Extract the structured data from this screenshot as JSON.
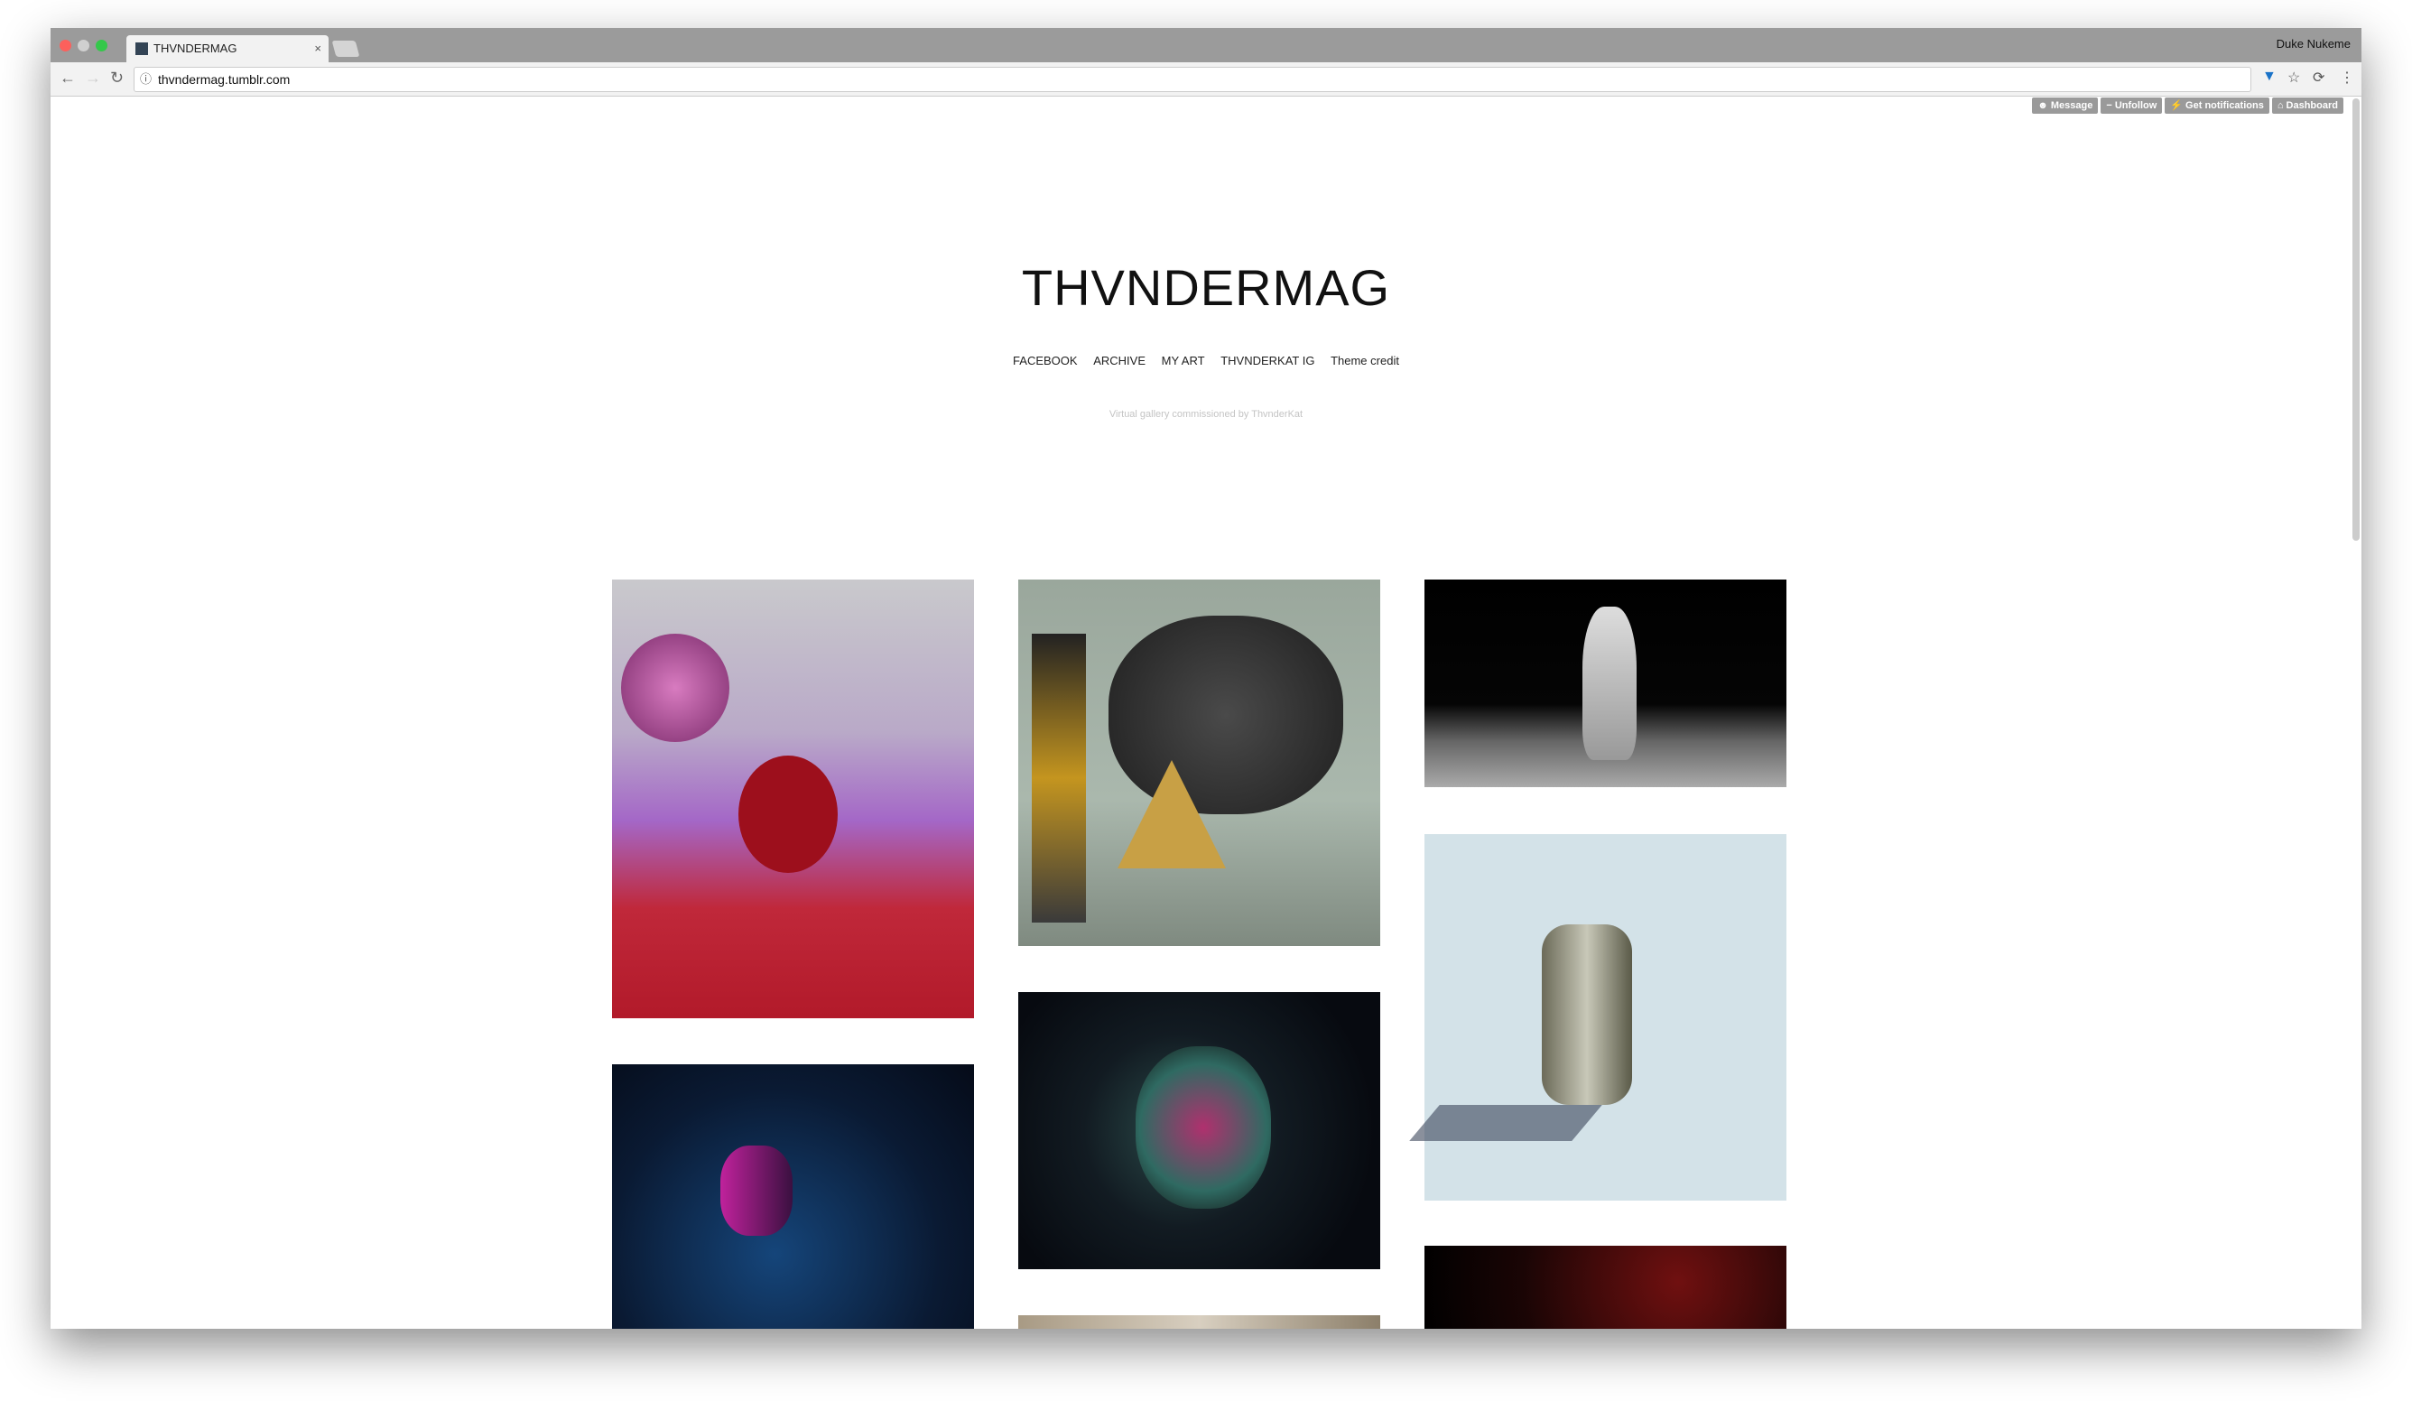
{
  "browser": {
    "tab_title": "THVNDERMAG",
    "url": "thvndermag.tumblr.com",
    "profile": "Duke Nukeme"
  },
  "tumblr_controls": {
    "message": "Message",
    "unfollow": "Unfollow",
    "notifications": "Get notifications",
    "dashboard": "Dashboard"
  },
  "blog": {
    "title": "THVNDERMAG",
    "links": [
      "FACEBOOK",
      "ARCHIVE",
      "MY ART",
      "THVNDERKAT IG",
      "Theme credit"
    ],
    "subtitle": "Virtual gallery commissioned by ThvnderKat"
  }
}
